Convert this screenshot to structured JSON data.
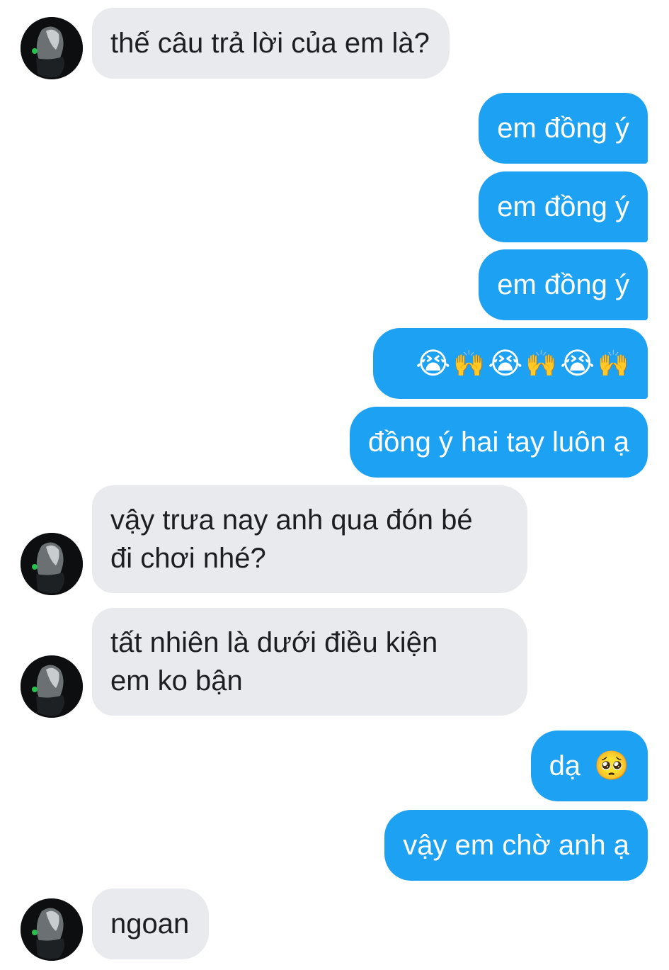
{
  "conversation": {
    "messages": [
      {
        "from": "other",
        "text": "thế câu trả lời của em là?"
      },
      {
        "from": "me",
        "text": "em đồng ý"
      },
      {
        "from": "me",
        "text": "em đồng ý"
      },
      {
        "from": "me",
        "text": "em đồng ý"
      },
      {
        "from": "me",
        "emojis": [
          "loudly-crying-face",
          "raising-hands",
          "loudly-crying-face",
          "raising-hands",
          "loudly-crying-face",
          "raising-hands"
        ]
      },
      {
        "from": "me",
        "text": "đồng ý hai tay luôn ạ"
      },
      {
        "from": "other",
        "text": "vậy trưa nay anh qua đón bé\nđi chơi nhé?"
      },
      {
        "from": "other",
        "text": "tất nhiên là dưới điều kiện\nem ko bận"
      },
      {
        "from": "me",
        "text": "dạ",
        "emoji": "pleading-face"
      },
      {
        "from": "me",
        "text": "vậy em chờ anh ạ"
      },
      {
        "from": "other",
        "text": "ngoan"
      }
    ]
  },
  "colors": {
    "sent_bubble": "#1da1f2",
    "received_bubble": "#e9eaee",
    "sent_text": "#ffffff",
    "received_text": "#1c1e21"
  },
  "icons": {
    "avatar": "profile-photo",
    "emoji_cry": "😭",
    "emoji_hands": "🙌",
    "emoji_pleading": "🥺"
  }
}
